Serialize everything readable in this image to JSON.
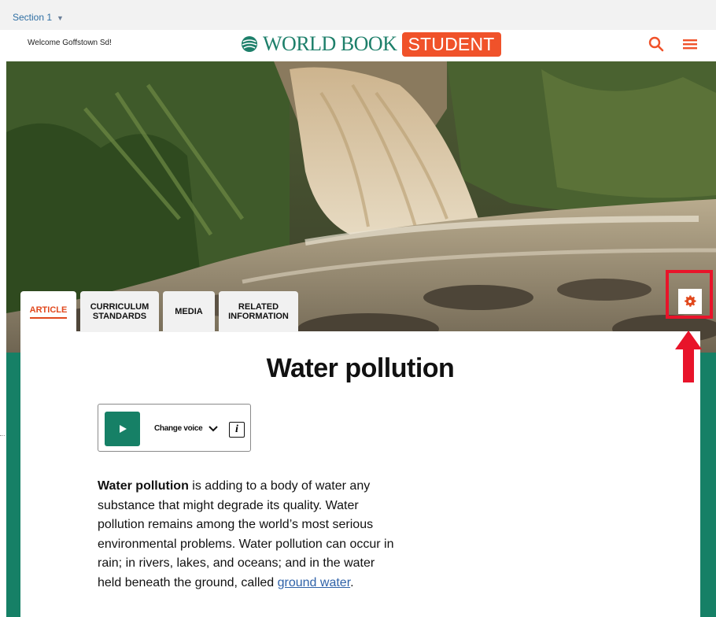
{
  "topbar": {
    "section_label": "Section 1"
  },
  "header": {
    "welcome_text": "Welcome Goffstown Sd!",
    "logo_world": "WORLD BOOK",
    "logo_student": "STUDENT"
  },
  "tabs": [
    {
      "label": "ARTICLE",
      "active": true
    },
    {
      "label": "CURRICULUM STANDARDS",
      "active": false
    },
    {
      "label": "MEDIA",
      "active": false
    },
    {
      "label": "RELATED INFORMATION",
      "active": false
    }
  ],
  "article": {
    "title": "Water pollution",
    "audio": {
      "voice_label": "Change voice"
    },
    "body_bold": "Water pollution",
    "body_text": " is adding to a body of water any substance that might degrade its quality. Water pollution remains among the world’s most serious environmental problems. Water pollution can occur in rain; in rivers, lakes, and oceans; and in the water held beneath the ground, called ",
    "body_link": "ground water",
    "body_end": "."
  },
  "icons": {
    "search": "search-icon",
    "menu": "hamburger-menu-icon",
    "settings": "gear-icon",
    "play": "play-icon",
    "chevron": "chevron-down-icon",
    "info": "info-icon",
    "arrow": "red-up-arrow-annotation"
  },
  "colors": {
    "brand_green": "#168066",
    "brand_orange": "#f0522a",
    "highlight_red": "#e8142a",
    "link_blue": "#2f62a8"
  }
}
